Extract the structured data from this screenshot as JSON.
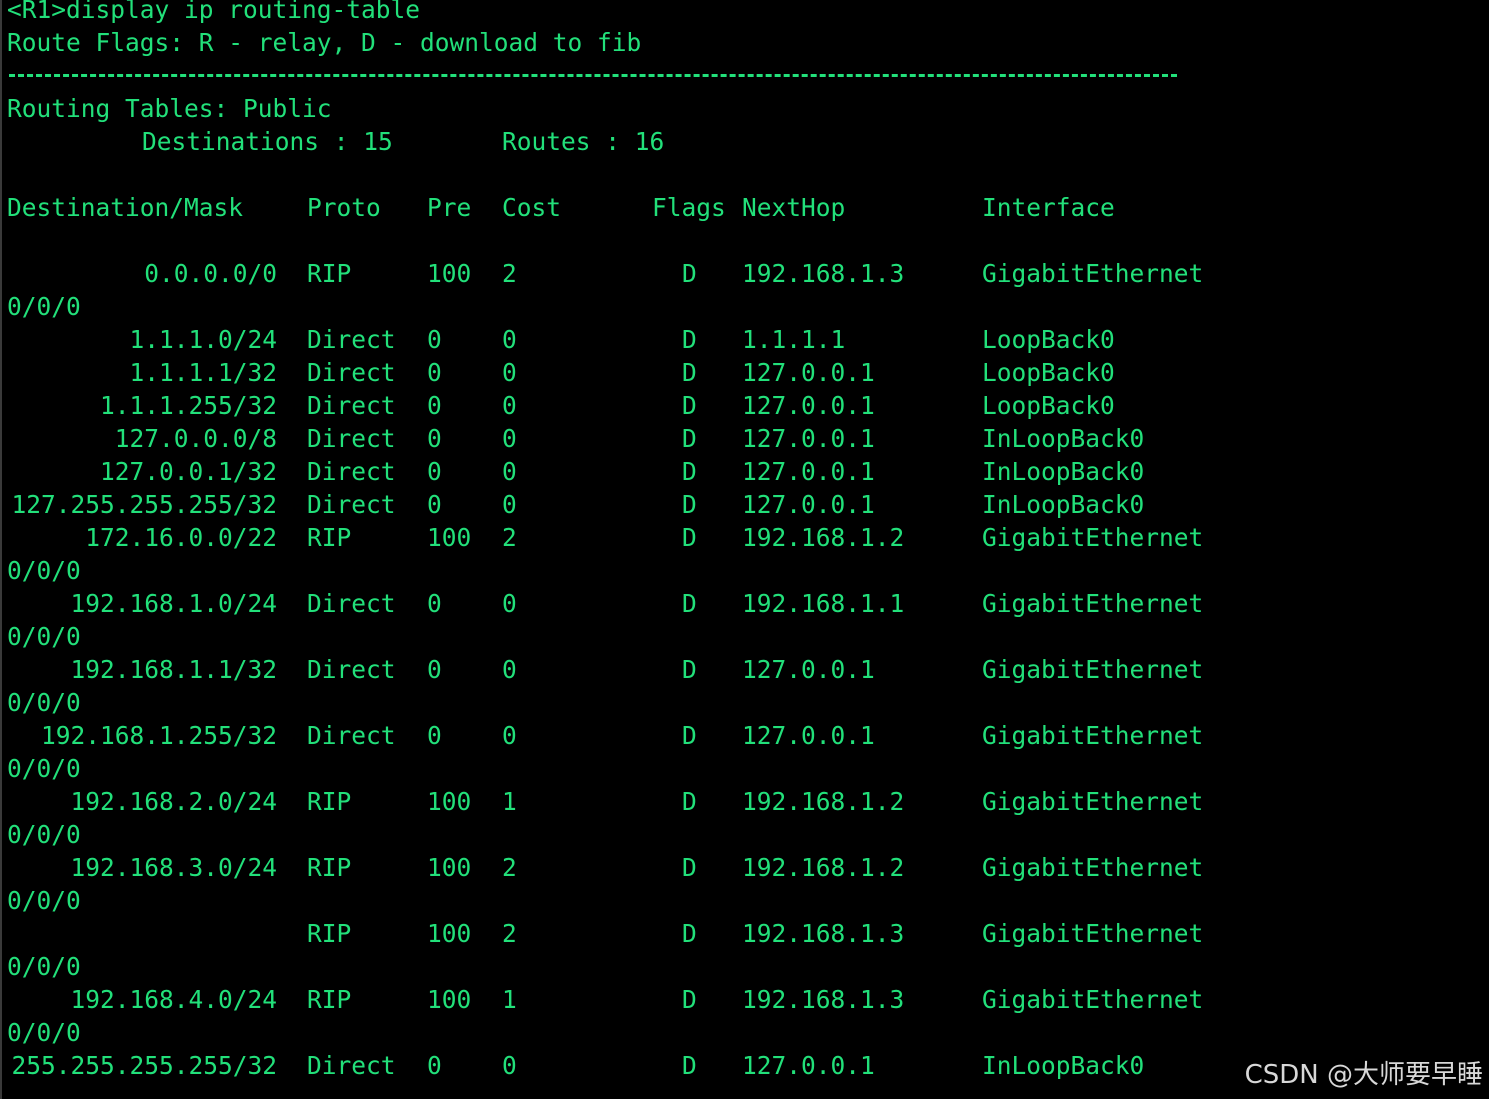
{
  "terminal": {
    "command": "<R1>display ip routing-table",
    "flags_legend": "Route Flags: R - relay, D - download to fib",
    "table_title": "Routing Tables: Public",
    "destinations_label": "Destinations : 15",
    "routes_label": "Routes : 16",
    "headers": {
      "destination": "Destination/Mask",
      "proto": "Proto",
      "pre": "Pre",
      "cost": "Cost",
      "flags": "Flags",
      "nexthop": "NextHop",
      "interface": "Interface"
    },
    "rows": [
      {
        "dest": "0.0.0.0/0",
        "proto": "RIP",
        "pre": "100",
        "cost": "2",
        "flags": "D",
        "nexthop": "192.168.1.3",
        "iface": "GigabitEthernet",
        "iface_cont": "0/0/0"
      },
      {
        "dest": "1.1.1.0/24",
        "proto": "Direct",
        "pre": "0",
        "cost": "0",
        "flags": "D",
        "nexthop": "1.1.1.1",
        "iface": "LoopBack0",
        "iface_cont": ""
      },
      {
        "dest": "1.1.1.1/32",
        "proto": "Direct",
        "pre": "0",
        "cost": "0",
        "flags": "D",
        "nexthop": "127.0.0.1",
        "iface": "LoopBack0",
        "iface_cont": ""
      },
      {
        "dest": "1.1.1.255/32",
        "proto": "Direct",
        "pre": "0",
        "cost": "0",
        "flags": "D",
        "nexthop": "127.0.0.1",
        "iface": "LoopBack0",
        "iface_cont": ""
      },
      {
        "dest": "127.0.0.0/8",
        "proto": "Direct",
        "pre": "0",
        "cost": "0",
        "flags": "D",
        "nexthop": "127.0.0.1",
        "iface": "InLoopBack0",
        "iface_cont": ""
      },
      {
        "dest": "127.0.0.1/32",
        "proto": "Direct",
        "pre": "0",
        "cost": "0",
        "flags": "D",
        "nexthop": "127.0.0.1",
        "iface": "InLoopBack0",
        "iface_cont": ""
      },
      {
        "dest": "127.255.255.255/32",
        "proto": "Direct",
        "pre": "0",
        "cost": "0",
        "flags": "D",
        "nexthop": "127.0.0.1",
        "iface": "InLoopBack0",
        "iface_cont": ""
      },
      {
        "dest": "172.16.0.0/22",
        "proto": "RIP",
        "pre": "100",
        "cost": "2",
        "flags": "D",
        "nexthop": "192.168.1.2",
        "iface": "GigabitEthernet",
        "iface_cont": "0/0/0"
      },
      {
        "dest": "192.168.1.0/24",
        "proto": "Direct",
        "pre": "0",
        "cost": "0",
        "flags": "D",
        "nexthop": "192.168.1.1",
        "iface": "GigabitEthernet",
        "iface_cont": "0/0/0"
      },
      {
        "dest": "192.168.1.1/32",
        "proto": "Direct",
        "pre": "0",
        "cost": "0",
        "flags": "D",
        "nexthop": "127.0.0.1",
        "iface": "GigabitEthernet",
        "iface_cont": "0/0/0"
      },
      {
        "dest": "192.168.1.255/32",
        "proto": "Direct",
        "pre": "0",
        "cost": "0",
        "flags": "D",
        "nexthop": "127.0.0.1",
        "iface": "GigabitEthernet",
        "iface_cont": "0/0/0"
      },
      {
        "dest": "192.168.2.0/24",
        "proto": "RIP",
        "pre": "100",
        "cost": "1",
        "flags": "D",
        "nexthop": "192.168.1.2",
        "iface": "GigabitEthernet",
        "iface_cont": "0/0/0"
      },
      {
        "dest": "192.168.3.0/24",
        "proto": "RIP",
        "pre": "100",
        "cost": "2",
        "flags": "D",
        "nexthop": "192.168.1.2",
        "iface": "GigabitEthernet",
        "iface_cont": "0/0/0"
      },
      {
        "dest": "",
        "proto": "RIP",
        "pre": "100",
        "cost": "2",
        "flags": "D",
        "nexthop": "192.168.1.3",
        "iface": "GigabitEthernet",
        "iface_cont": "0/0/0"
      },
      {
        "dest": "192.168.4.0/24",
        "proto": "RIP",
        "pre": "100",
        "cost": "1",
        "flags": "D",
        "nexthop": "192.168.1.3",
        "iface": "GigabitEthernet",
        "iface_cont": "0/0/0"
      },
      {
        "dest": "255.255.255.255/32",
        "proto": "Direct",
        "pre": "0",
        "cost": "0",
        "flags": "D",
        "nexthop": "127.0.0.1",
        "iface": "InLoopBack0",
        "iface_cont": ""
      }
    ]
  },
  "watermark": "CSDN @大师要早睡",
  "colors": {
    "background": "#000000",
    "text": "#22e07a",
    "watermark": "#d8d8d8"
  }
}
